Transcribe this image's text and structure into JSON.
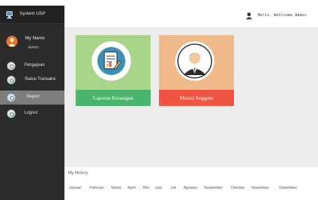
{
  "sidebar": {
    "brand": "System USP",
    "user": {
      "name": "My Name",
      "role": "Admin"
    },
    "items": [
      {
        "label": "Pengajuan",
        "icon": "document-icon",
        "active": false
      },
      {
        "label": "Status Transaksi",
        "icon": "status-icon",
        "active": false
      },
      {
        "label": "Report",
        "icon": "report-icon",
        "active": true
      },
      {
        "label": "Logout",
        "icon": "logout-icon",
        "active": false
      }
    ]
  },
  "header": {
    "greeting": "Hello, Wellcome Admin",
    "icon": "admin-user-icon"
  },
  "cards": [
    {
      "label": "Laporan Keuangan",
      "icon": "financial-report-icon",
      "color": "#a8d58a",
      "footer_color": "#4bb56f"
    },
    {
      "label": "Mutasi Anggota",
      "icon": "member-avatar-icon",
      "color": "#f0b98a",
      "footer_color": "#ef5342"
    }
  ],
  "history": {
    "title": "My History",
    "months": [
      "Januari",
      "Februari",
      "Maret",
      "April",
      "Mei",
      "Juni",
      "Juli",
      "Agustus",
      "September",
      "Oktober",
      "November",
      "Desember"
    ]
  },
  "colors": {
    "sidebar": "#2b2b2b",
    "active_item": "#7d7d7d",
    "content_bg": "#ececec"
  }
}
